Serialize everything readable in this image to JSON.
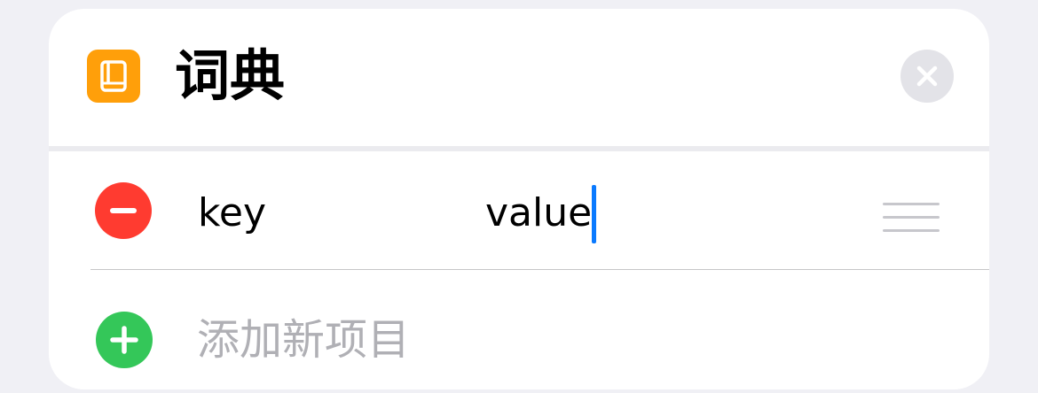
{
  "header": {
    "title": "词典",
    "app_icon": "book-icon",
    "close_icon": "close-icon"
  },
  "entries": [
    {
      "key": "key",
      "value": "value"
    }
  ],
  "add_row": {
    "label": "添加新项目"
  },
  "colors": {
    "app_icon_bg": "#FF9F0A",
    "remove_button": "#FF3B30",
    "add_button": "#34C759",
    "caret": "#0A7AFF",
    "placeholder_text": "#B0B0B5",
    "close_button_bg": "#E3E3E8"
  }
}
